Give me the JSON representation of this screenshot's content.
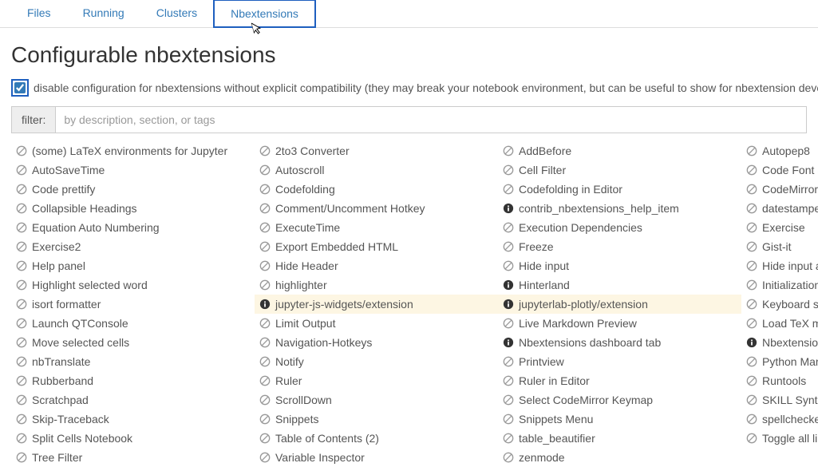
{
  "tabs": {
    "files": "Files",
    "running": "Running",
    "clusters": "Clusters",
    "nbextensions": "Nbextensions"
  },
  "title": "Configurable nbextensions",
  "compat_checkbox_checked": true,
  "compat_text": "disable configuration for nbextensions without explicit compatibility (they may break your notebook environment, but can be useful to show for nbextension develo",
  "filter": {
    "label": "filter:",
    "placeholder": "by description, section, or tags"
  },
  "extensions": [
    {
      "label": "(some) LaTeX environments for Jupyter",
      "icon": "disabled",
      "hl": false
    },
    {
      "label": "2to3 Converter",
      "icon": "disabled",
      "hl": false
    },
    {
      "label": "AddBefore",
      "icon": "disabled",
      "hl": false
    },
    {
      "label": "Autopep8",
      "icon": "disabled",
      "hl": false
    },
    {
      "label": "AutoSaveTime",
      "icon": "disabled",
      "hl": false
    },
    {
      "label": "Autoscroll",
      "icon": "disabled",
      "hl": false
    },
    {
      "label": "Cell Filter",
      "icon": "disabled",
      "hl": false
    },
    {
      "label": "Code Font S",
      "icon": "disabled",
      "hl": false
    },
    {
      "label": "Code prettify",
      "icon": "disabled",
      "hl": false
    },
    {
      "label": "Codefolding",
      "icon": "disabled",
      "hl": false
    },
    {
      "label": "Codefolding in Editor",
      "icon": "disabled",
      "hl": false
    },
    {
      "label": "CodeMirror",
      "icon": "disabled",
      "hl": false
    },
    {
      "label": "Collapsible Headings",
      "icon": "disabled",
      "hl": false
    },
    {
      "label": "Comment/Uncomment Hotkey",
      "icon": "disabled",
      "hl": false
    },
    {
      "label": "contrib_nbextensions_help_item",
      "icon": "info",
      "hl": false
    },
    {
      "label": "datestampe",
      "icon": "disabled",
      "hl": false
    },
    {
      "label": "Equation Auto Numbering",
      "icon": "disabled",
      "hl": false
    },
    {
      "label": "ExecuteTime",
      "icon": "disabled",
      "hl": false
    },
    {
      "label": "Execution Dependencies",
      "icon": "disabled",
      "hl": false
    },
    {
      "label": "Exercise",
      "icon": "disabled",
      "hl": false
    },
    {
      "label": "Exercise2",
      "icon": "disabled",
      "hl": false
    },
    {
      "label": "Export Embedded HTML",
      "icon": "disabled",
      "hl": false
    },
    {
      "label": "Freeze",
      "icon": "disabled",
      "hl": false
    },
    {
      "label": "Gist-it",
      "icon": "disabled",
      "hl": false
    },
    {
      "label": "Help panel",
      "icon": "disabled",
      "hl": false
    },
    {
      "label": "Hide Header",
      "icon": "disabled",
      "hl": false
    },
    {
      "label": "Hide input",
      "icon": "disabled",
      "hl": false
    },
    {
      "label": "Hide input a",
      "icon": "disabled",
      "hl": false
    },
    {
      "label": "Highlight selected word",
      "icon": "disabled",
      "hl": false
    },
    {
      "label": "highlighter",
      "icon": "disabled",
      "hl": false
    },
    {
      "label": "Hinterland",
      "icon": "info",
      "hl": false
    },
    {
      "label": "Initialization",
      "icon": "disabled",
      "hl": false
    },
    {
      "label": "isort formatter",
      "icon": "disabled",
      "hl": false
    },
    {
      "label": "jupyter-js-widgets/extension",
      "icon": "info",
      "hl": true
    },
    {
      "label": "jupyterlab-plotly/extension",
      "icon": "info",
      "hl": true
    },
    {
      "label": "Keyboard s",
      "icon": "disabled",
      "hl": false
    },
    {
      "label": "Launch QTConsole",
      "icon": "disabled",
      "hl": false
    },
    {
      "label": "Limit Output",
      "icon": "disabled",
      "hl": false
    },
    {
      "label": "Live Markdown Preview",
      "icon": "disabled",
      "hl": false
    },
    {
      "label": "Load TeX m",
      "icon": "disabled",
      "hl": false
    },
    {
      "label": "Move selected cells",
      "icon": "disabled",
      "hl": false
    },
    {
      "label": "Navigation-Hotkeys",
      "icon": "disabled",
      "hl": false
    },
    {
      "label": "Nbextensions dashboard tab",
      "icon": "info",
      "hl": false
    },
    {
      "label": "Nbextensio",
      "icon": "info",
      "hl": false
    },
    {
      "label": "nbTranslate",
      "icon": "disabled",
      "hl": false
    },
    {
      "label": "Notify",
      "icon": "disabled",
      "hl": false
    },
    {
      "label": "Printview",
      "icon": "disabled",
      "hl": false
    },
    {
      "label": "Python Mar",
      "icon": "disabled",
      "hl": false
    },
    {
      "label": "Rubberband",
      "icon": "disabled",
      "hl": false
    },
    {
      "label": "Ruler",
      "icon": "disabled",
      "hl": false
    },
    {
      "label": "Ruler in Editor",
      "icon": "disabled",
      "hl": false
    },
    {
      "label": "Runtools",
      "icon": "disabled",
      "hl": false
    },
    {
      "label": "Scratchpad",
      "icon": "disabled",
      "hl": false
    },
    {
      "label": "ScrollDown",
      "icon": "disabled",
      "hl": false
    },
    {
      "label": "Select CodeMirror Keymap",
      "icon": "disabled",
      "hl": false
    },
    {
      "label": "SKILL Synt",
      "icon": "disabled",
      "hl": false
    },
    {
      "label": "Skip-Traceback",
      "icon": "disabled",
      "hl": false
    },
    {
      "label": "Snippets",
      "icon": "disabled",
      "hl": false
    },
    {
      "label": "Snippets Menu",
      "icon": "disabled",
      "hl": false
    },
    {
      "label": "spellchecke",
      "icon": "disabled",
      "hl": false
    },
    {
      "label": "Split Cells Notebook",
      "icon": "disabled",
      "hl": false
    },
    {
      "label": "Table of Contents (2)",
      "icon": "disabled",
      "hl": false
    },
    {
      "label": "table_beautifier",
      "icon": "disabled",
      "hl": false
    },
    {
      "label": "Toggle all li",
      "icon": "disabled",
      "hl": false
    },
    {
      "label": "Tree Filter",
      "icon": "disabled",
      "hl": false
    },
    {
      "label": "Variable Inspector",
      "icon": "disabled",
      "hl": false
    },
    {
      "label": "zenmode",
      "icon": "disabled",
      "hl": false
    }
  ]
}
